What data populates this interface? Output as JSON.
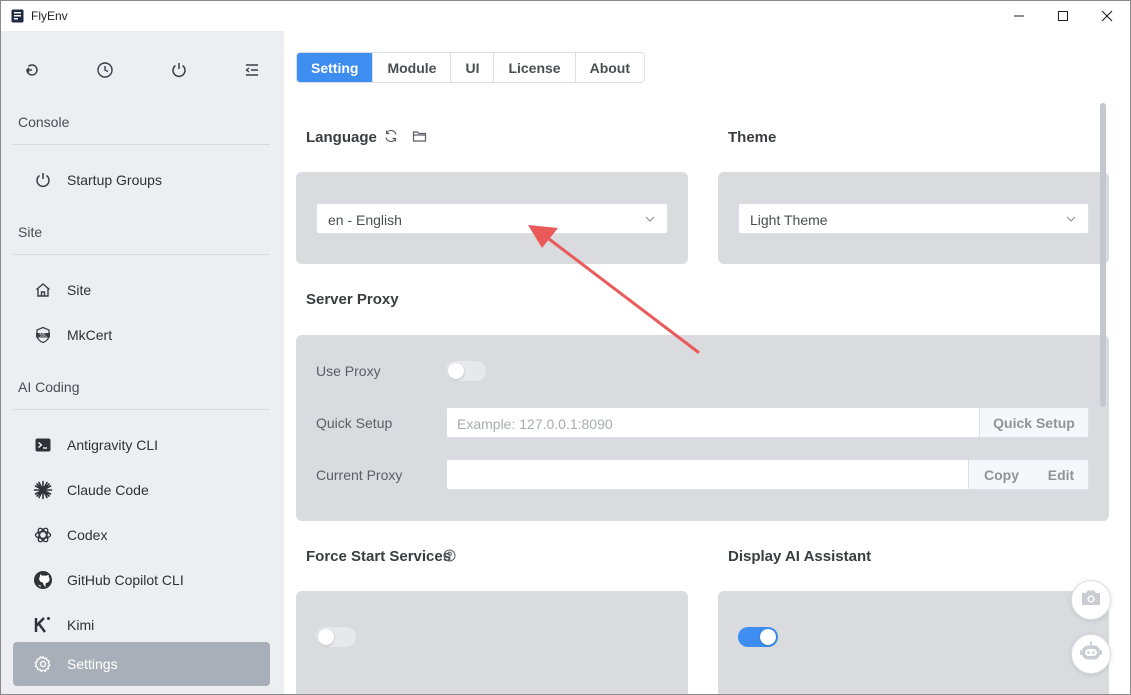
{
  "window": {
    "title": "FlyEnv"
  },
  "sidebar": {
    "sections": [
      {
        "title": "Console"
      },
      {
        "title": "Site"
      },
      {
        "title": "AI Coding"
      }
    ],
    "items": [
      {
        "label": "Startup Groups",
        "icon": "power-icon"
      },
      {
        "label": "Site",
        "icon": "home-icon"
      },
      {
        "label": "MkCert",
        "icon": "ssl-badge-icon"
      },
      {
        "label": "Antigravity CLI",
        "icon": "terminal-icon"
      },
      {
        "label": "Claude Code",
        "icon": "claude-burst-icon"
      },
      {
        "label": "Codex",
        "icon": "openai-icon"
      },
      {
        "label": "GitHub Copilot CLI",
        "icon": "github-icon"
      },
      {
        "label": "Kimi",
        "icon": "kimi-icon"
      },
      {
        "label": "Settings",
        "icon": "gear-icon",
        "active": true
      }
    ]
  },
  "tabs": [
    {
      "label": "Setting",
      "active": true
    },
    {
      "label": "Module"
    },
    {
      "label": "UI"
    },
    {
      "label": "License"
    },
    {
      "label": "About"
    }
  ],
  "language": {
    "heading": "Language",
    "value": "en - English"
  },
  "theme": {
    "heading": "Theme",
    "value": "Light Theme"
  },
  "server_proxy": {
    "heading": "Server Proxy",
    "use_proxy_label": "Use Proxy",
    "use_proxy_on": false,
    "quick_setup_label": "Quick Setup",
    "quick_setup_placeholder": "Example: 127.0.0.1:8090",
    "quick_setup_button": "Quick Setup",
    "current_proxy_label": "Current Proxy",
    "current_proxy_value": "",
    "copy_button": "Copy",
    "edit_button": "Edit"
  },
  "force_start": {
    "heading": "Force Start Services",
    "enabled": false
  },
  "ai_assistant": {
    "heading": "Display AI Assistant",
    "enabled": true
  },
  "colors": {
    "accent": "#3d8ef0",
    "annotation_arrow": "#ea5a5a",
    "panel": "#d9dbdf",
    "sidebar": "#eceef1",
    "sidebar_active": "#a9afb8"
  }
}
